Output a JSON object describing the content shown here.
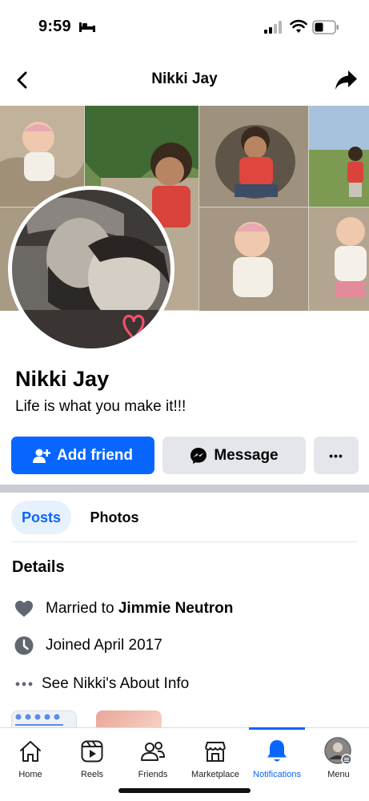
{
  "status_bar": {
    "time": "9:59"
  },
  "nav": {
    "title": "Nikki Jay"
  },
  "profile": {
    "name": "Nikki Jay",
    "bio": "Life is what you make it!!!"
  },
  "actions": {
    "add_friend": "Add friend",
    "message": "Message",
    "more": "•••"
  },
  "tabs": [
    {
      "label": "Posts",
      "active": true
    },
    {
      "label": "Photos",
      "active": false
    }
  ],
  "details": {
    "heading": "Details",
    "married_prefix": "Married to ",
    "married_name": "Jimmie Neutron",
    "joined": "Joined April 2017",
    "about": "See Nikki's About Info"
  },
  "bottom_nav": [
    {
      "label": "Home",
      "icon": "home-icon"
    },
    {
      "label": "Reels",
      "icon": "reels-icon"
    },
    {
      "label": "Friends",
      "icon": "friends-icon"
    },
    {
      "label": "Marketplace",
      "icon": "marketplace-icon"
    },
    {
      "label": "Notifications",
      "icon": "bell-icon",
      "active": true
    },
    {
      "label": "Menu",
      "icon": "avatar-menu-icon"
    }
  ],
  "colors": {
    "accent": "#0866ff",
    "button_grey": "#e4e6eb",
    "tab_active_bg": "#e7f0fd"
  }
}
